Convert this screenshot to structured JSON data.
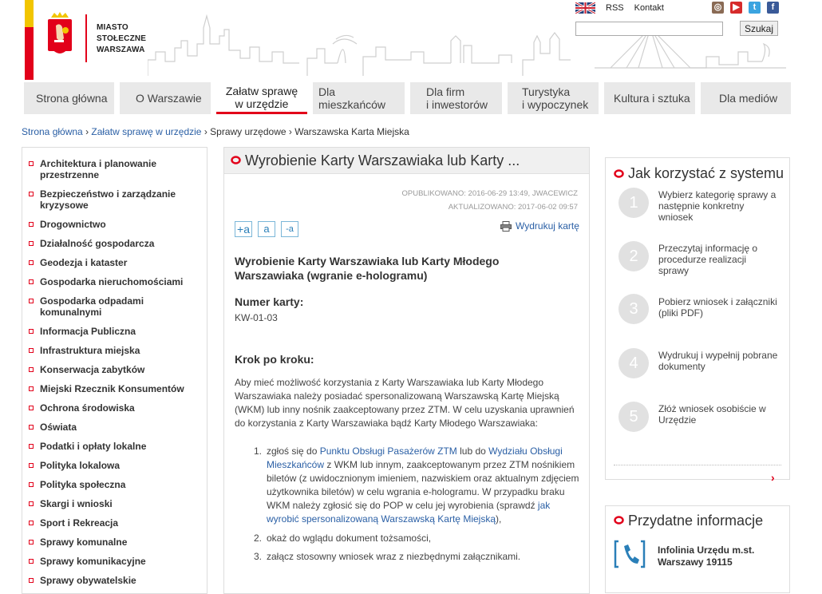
{
  "header": {
    "logo_text": [
      "MIASTO",
      "STOŁECZNE",
      "WARSZAWA"
    ],
    "top_links": [
      "RSS",
      "Kontakt"
    ],
    "search": {
      "placeholder": "",
      "button": "Szukaj"
    }
  },
  "nav": {
    "tabs": [
      {
        "line1": "Strona główna",
        "line2": ""
      },
      {
        "line1": "O Warszawie",
        "line2": ""
      },
      {
        "line1": "Załatw sprawę",
        "line2": "w urzędzie"
      },
      {
        "line1": "Dla mieszkańców",
        "line2": ""
      },
      {
        "line1": "Dla firm",
        "line2": "i inwestorów"
      },
      {
        "line1": "Turystyka",
        "line2": "i wypoczynek"
      },
      {
        "line1": "Kultura i sztuka",
        "line2": ""
      },
      {
        "line1": "Dla mediów",
        "line2": ""
      }
    ]
  },
  "breadcrumb": {
    "items": [
      "Strona główna",
      "Załatw sprawę w urzędzie",
      "Sprawy urzędowe",
      "Warszawska Karta Miejska"
    ],
    "separator": "›"
  },
  "sidebar": {
    "items": [
      "Architektura i planowanie przestrzenne",
      "Bezpieczeństwo i zarządzanie kryzysowe",
      "Drogownictwo",
      "Działalność gospodarcza",
      "Geodezja i kataster",
      "Gospodarka nieruchomościami",
      "Gospodarka odpadami komunalnymi",
      "Informacja Publiczna",
      "Infrastruktura miejska",
      "Konserwacja zabytków",
      "Miejski Rzecznik Konsumentów",
      "Ochrona środowiska",
      "Oświata",
      "Podatki i opłaty lokalne",
      "Polityka lokalowa",
      "Polityka społeczna",
      "Skargi i wnioski",
      "Sport i Rekreacja",
      "Sprawy komunalne",
      "Sprawy komunikacyjne",
      "Sprawy obywatelskie"
    ]
  },
  "main": {
    "title": "Wyrobienie Karty Warszawiaka lub Karty ...",
    "published": "OPUBLIKOWANO: 2016-06-29 13:49, JWACEWICZ",
    "updated": "AKTUALIZOWANO: 2017-06-02 09:57",
    "font_buttons": [
      "+a",
      "a",
      "-a"
    ],
    "print_label": "Wydrukuj kartę",
    "doc_title": "Wyrobienie Karty Warszawiaka lub Karty Młodego Warszawiaka (wgranie e-hologramu)",
    "card_number_heading": "Numer karty:",
    "card_number": "KW-01-03",
    "steps_heading": "Krok po kroku:",
    "intro_lines": [
      "Aby mieć możliwość korzystania z Karty Warszawiaka lub Karty Młodego",
      "Warszawiaka należy posiadać spersonalizowaną Warszawską Kartę Miejską",
      "(WKM) lub inny nośnik zaakceptowany przez ZTM. W celu uzyskania uprawnień",
      "do korzystania z Karty Warszawiaka bądź Karty Młodego Warszawiaka:"
    ],
    "list": {
      "n1": "1.",
      "n2": "2.",
      "n3": "3.",
      "i1_a": "zgłoś się do ",
      "i1_link1": "Punktu Obsługi Pasażerów ZTM",
      "i1_b": " lub do ",
      "i1_link2a": "Wydziału Obsługi",
      "i1_link2b": "Mieszkańców",
      "i1_c": " z WKM lub innym, zaakceptowanym przez ZTM nośnikiem",
      "i1_d": "biletów (z uwidocznionym imieniem, nazwiskiem oraz aktualnym zdjęciem",
      "i1_e": "użytkownika biletów) w celu wgrania e-hologramu. W przypadku braku",
      "i1_f": "WKM należy zgłosić się do POP w celu jej wyrobienia (sprawdź ",
      "i1_link3a": "jak",
      "i1_link3b": "wyrobić spersonalizowaną Warszawską Kartę Miejską",
      "i1_g": "),",
      "i2": "okaż do wglądu dokument tożsamości,",
      "i3": "załącz stosowny wniosek wraz z niezbędnymi załącznikami."
    }
  },
  "how_to": {
    "title": "Jak korzystać z systemu",
    "steps": [
      {
        "num": "1",
        "text": "Wybierz kategorię sprawy a następnie konkretny wniosek"
      },
      {
        "num": "2",
        "text": "Przeczytaj informację o procedurze realizacji sprawy"
      },
      {
        "num": "3",
        "text": "Pobierz wniosek i załączniki (pliki PDF)"
      },
      {
        "num": "4",
        "text": "Wydrukuj i wypełnij pobrane dokumenty"
      },
      {
        "num": "5",
        "text": "Złóż wniosek osobiście w Urzędzie"
      }
    ],
    "next_arrow": "›"
  },
  "useful_info": {
    "title": "Przydatne informacje",
    "line1": "Infolinia Urzędu m.st.",
    "line2": "Warszawy 19115"
  },
  "colors": {
    "accent": "#e2001a",
    "link": "#2a5fa5",
    "flag_yellow": "#f2c500"
  }
}
